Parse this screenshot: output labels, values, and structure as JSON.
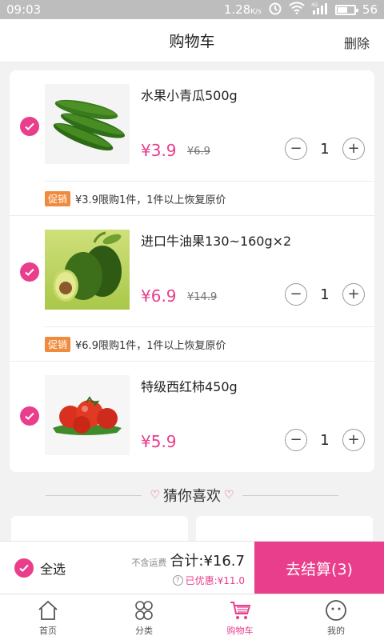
{
  "status_bar": {
    "time": "09:03",
    "speed": "1.28",
    "speed_unit": "K/s",
    "network": "4G",
    "battery": "56"
  },
  "header": {
    "title": "购物车",
    "delete_label": "删除"
  },
  "cart_items": [
    {
      "name": "水果小青瓜500g",
      "price": "¥3.9",
      "old_price": "¥6.9",
      "quantity": "1",
      "promo_tag": "促销",
      "promo_text": "¥3.9限购1件，1件以上恢复原价",
      "image": "cucumber-image",
      "checked": true
    },
    {
      "name": "进口牛油果130~160g×2",
      "price": "¥6.9",
      "old_price": "¥14.9",
      "quantity": "1",
      "promo_tag": "促销",
      "promo_text": "¥6.9限购1件，1件以上恢复原价",
      "image": "avocado-image",
      "checked": true
    },
    {
      "name": "特级西红柿450g",
      "price": "¥5.9",
      "quantity": "1",
      "image": "tomato-image",
      "checked": true
    }
  ],
  "qty_controls": {
    "minus": "−",
    "plus": "+"
  },
  "guess": {
    "title": "猜你喜欢"
  },
  "checkout": {
    "select_all": "全选",
    "no_shipping": "不含运费",
    "total": "合计:¥16.7",
    "discount": "已优惠:¥11.0",
    "help_mark": "?",
    "pay_button": "去结算(3)"
  },
  "tabs": [
    {
      "label": "首页",
      "icon": "home-icon"
    },
    {
      "label": "分类",
      "icon": "category-icon"
    },
    {
      "label": "购物车",
      "icon": "cart-icon",
      "active": true
    },
    {
      "label": "我的",
      "icon": "profile-icon"
    }
  ],
  "colors": {
    "accent": "#e83e8c",
    "promo_tag": "#f08a3c",
    "status_bar": "#bdbdbd"
  }
}
